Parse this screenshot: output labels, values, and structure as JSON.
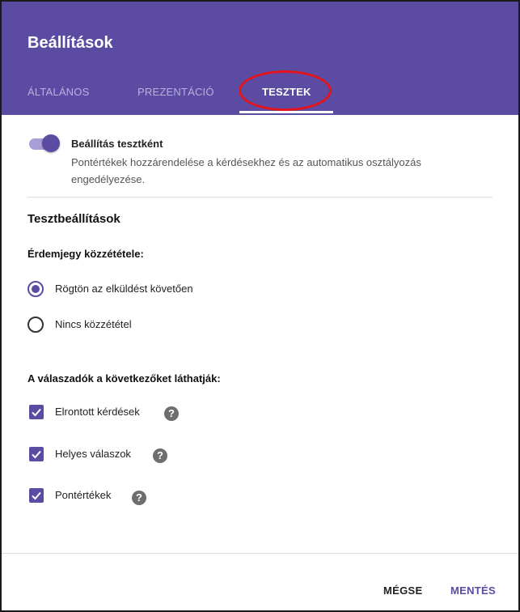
{
  "dialog": {
    "title": "Beállítások",
    "tabs": [
      {
        "label": "ÁLTALÁNOS",
        "active": false
      },
      {
        "label": "PREZENTÁCIÓ",
        "active": false
      },
      {
        "label": "TESZTEK",
        "active": true
      }
    ]
  },
  "quiz_toggle": {
    "label": "Beállítás tesztként",
    "description": "Pontértékek hozzárendelése a kérdésekhez és az automatikus osztályozás engedélyezése.",
    "on": true
  },
  "settings": {
    "title": "Tesztbeállítások",
    "release": {
      "title": "Érdemjegy közzététele:",
      "options": [
        {
          "label": "Rögtön az elküldést követően",
          "selected": true
        },
        {
          "label": "Nincs közzététel",
          "selected": false
        }
      ]
    },
    "visibility": {
      "title": "A válaszadók a következőket láthatják:",
      "options": [
        {
          "label": "Elrontott kérdések",
          "checked": true
        },
        {
          "label": "Helyes válaszok",
          "checked": true
        },
        {
          "label": "Pontértékek",
          "checked": true
        }
      ]
    }
  },
  "help_glyph": "?",
  "icons": {
    "help": "help-icon",
    "check": "check-icon"
  },
  "colors": {
    "accent": "#5c4ba3",
    "highlight_circle": "#e3131b"
  },
  "footer": {
    "cancel_label": "MÉGSE",
    "save_label": "MENTÉS"
  }
}
